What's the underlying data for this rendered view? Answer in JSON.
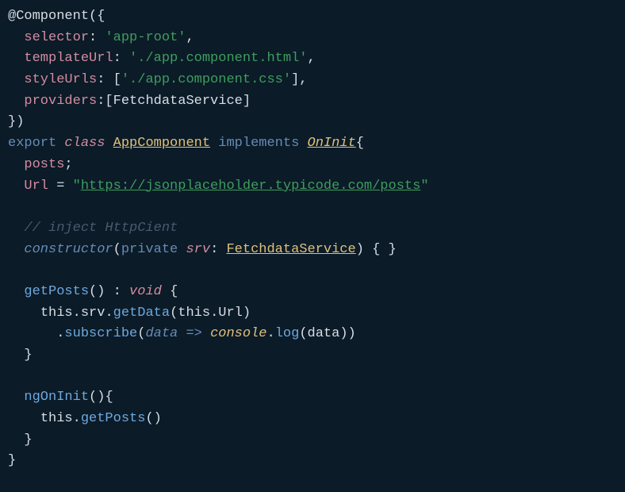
{
  "code": {
    "l1_decorator": "@Component",
    "l1_open": "({",
    "l2_prop": "selector",
    "l2_val": "'app-root'",
    "l3_prop": "templateUrl",
    "l3_val": "'./app.component.html'",
    "l4_prop": "styleUrls",
    "l4_val": "'./app.component.css'",
    "l5_prop": "providers",
    "l5_val": "FetchdataService",
    "l6_close": "})",
    "l7_export": "export",
    "l7_class": "class",
    "l7_name": "AppComponent",
    "l7_implements": "implements",
    "l7_interface": "OnInit",
    "l8_member": "posts",
    "l9_member": "Url",
    "l9_eq": "=",
    "l9_q": "\"",
    "l9_url": "https://jsonplaceholder.typicode.com/posts",
    "l11_comment": "// inject HttpCient",
    "l12_ctor": "constructor",
    "l12_private": "private",
    "l12_param": "srv",
    "l12_type": "FetchdataService",
    "l12_body": "{ }",
    "l14_method": "getPosts",
    "l14_void": "void",
    "l15_this": "this",
    "l15_srv": "srv",
    "l15_getdata": "getData",
    "l15_arg_this": "this",
    "l15_arg_url": "Url",
    "l16_subscribe": "subscribe",
    "l16_param": "data",
    "l16_arrow": "=>",
    "l16_console": "console",
    "l16_log": "log",
    "l16_arg": "data",
    "l19_method": "ngOnInit",
    "l20_this": "this",
    "l20_call": "getPosts"
  }
}
